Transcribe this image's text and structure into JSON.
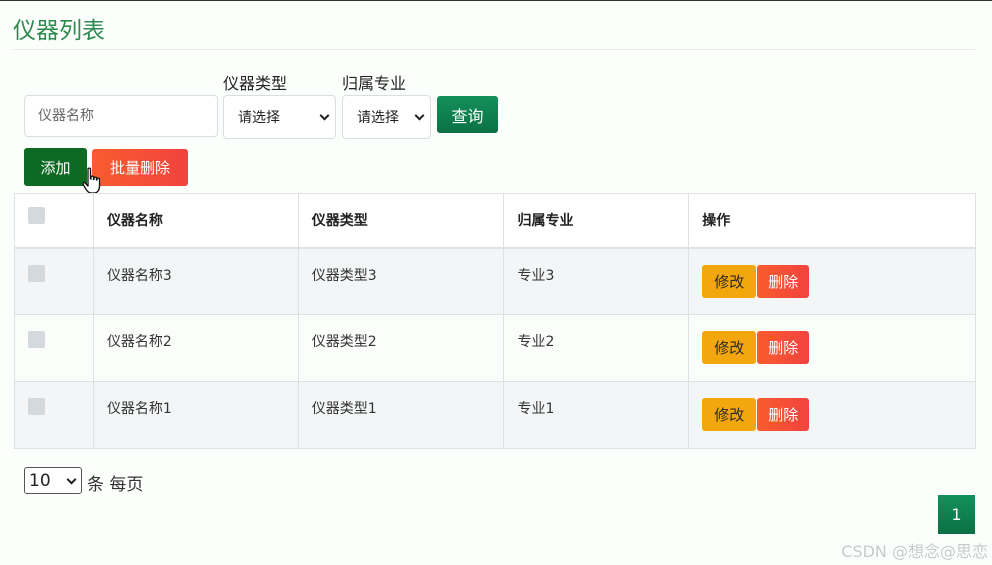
{
  "page": {
    "title": "仪器列表"
  },
  "filters": {
    "name_placeholder": "仪器名称",
    "type_label": "仪器类型",
    "type_value": "请选择",
    "major_label": "归属专业",
    "major_value": "请选择",
    "query_label": "查询"
  },
  "toolbar": {
    "add_label": "添加",
    "batch_delete_label": "批量删除"
  },
  "table": {
    "columns": [
      "",
      "仪器名称",
      "仪器类型",
      "归属专业",
      "操作"
    ],
    "rows": [
      {
        "name": "仪器名称3",
        "type": "仪器类型3",
        "major": "专业3"
      },
      {
        "name": "仪器名称2",
        "type": "仪器类型2",
        "major": "专业2"
      },
      {
        "name": "仪器名称1",
        "type": "仪器类型1",
        "major": "专业1"
      }
    ],
    "edit_label": "修改",
    "delete_label": "删除"
  },
  "pagination": {
    "page_size": "10",
    "per_page_label": "条 每页",
    "current_page": "1"
  },
  "watermark": "CSDN @想念@思恋",
  "colors": {
    "title": "#2e8b4f",
    "primary": "#0b7045",
    "add": "#0d6a22",
    "danger": "#f1433e",
    "warning": "#f4a70d"
  },
  "icons": {
    "cursor": "hand-pointer-icon"
  }
}
